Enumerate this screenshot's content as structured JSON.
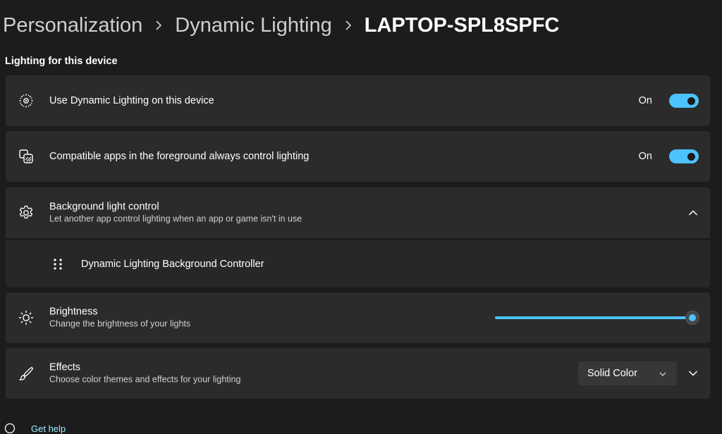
{
  "breadcrumb": {
    "items": [
      "Personalization",
      "Dynamic Lighting"
    ],
    "current": "LAPTOP-SPL8SPFC"
  },
  "section_title": "Lighting for this device",
  "settings": {
    "use_dynamic_lighting": {
      "icon": "dynamic-lighting-icon",
      "title": "Use Dynamic Lighting on this device",
      "state_label": "On",
      "enabled": true
    },
    "compatible_apps": {
      "icon": "apps-lighting-icon",
      "title": "Compatible apps in the foreground always control lighting",
      "state_label": "On",
      "enabled": true
    },
    "background_light_control": {
      "icon": "gear-icon",
      "title": "Background light control",
      "subtitle": "Let another app control lighting when an app or game isn't in use",
      "expanded": true,
      "controller_item": "Dynamic Lighting Background Controller"
    },
    "brightness": {
      "icon": "sun-icon",
      "title": "Brightness",
      "subtitle": "Change the brightness of your lights",
      "value_percent": 100
    },
    "effects": {
      "icon": "brush-icon",
      "title": "Effects",
      "subtitle": "Choose color themes and effects for your lighting",
      "selected": "Solid Color"
    }
  },
  "footer": {
    "get_help": "Get help"
  },
  "colors": {
    "accent": "#4cc2ff",
    "background": "#1c1c1c",
    "card": "#2b2b2b"
  }
}
